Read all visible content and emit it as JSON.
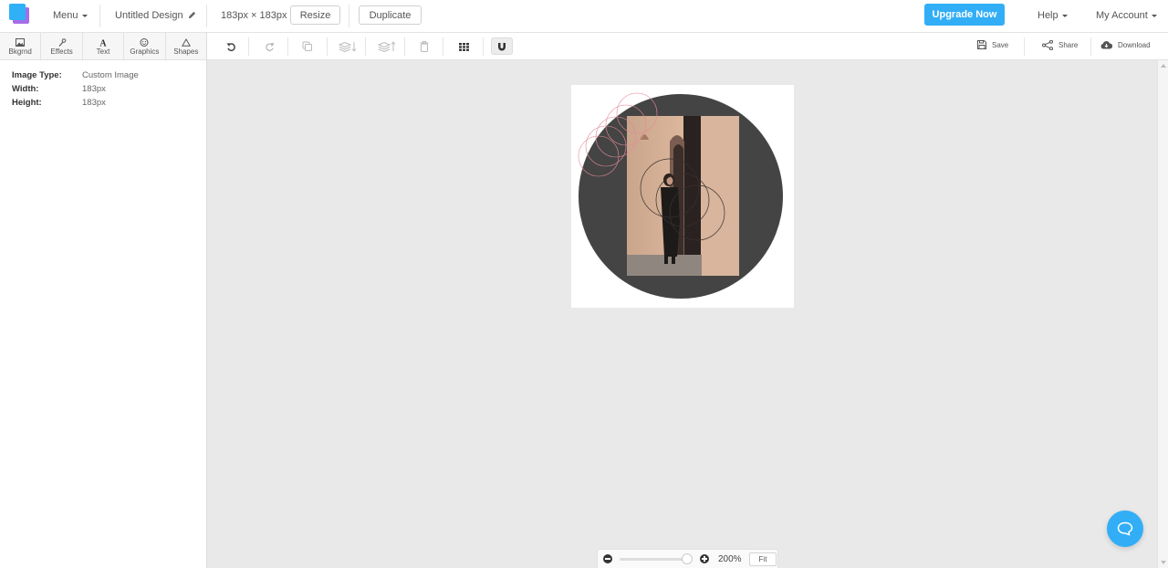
{
  "topbar": {
    "menu_label": "Menu",
    "design_name": "Untitled Design",
    "dimensions": "183px × 183px",
    "resize_label": "Resize",
    "duplicate_label": "Duplicate",
    "upgrade_label": "Upgrade Now",
    "help_label": "Help",
    "account_label": "My Account",
    "brand_color": "#32aef6"
  },
  "tool_tabs": [
    {
      "label": "Bkgrnd",
      "icon": "image-icon"
    },
    {
      "label": "Effects",
      "icon": "magic-wand-icon"
    },
    {
      "label": "Text",
      "icon": "text-icon"
    },
    {
      "label": "Graphics",
      "icon": "smiley-icon"
    },
    {
      "label": "Shapes",
      "icon": "triangle-icon"
    }
  ],
  "edit_toolbar": {
    "icons": [
      "undo-icon",
      "redo-icon",
      "duplicate-icon",
      "send-backward-icon",
      "bring-forward-icon",
      "delete-icon",
      "grid-icon",
      "magnet-icon"
    ],
    "save_label": "Save",
    "share_label": "Share",
    "download_label": "Download"
  },
  "properties": {
    "image_type_label": "Image Type:",
    "image_type_value": "Custom Image",
    "width_label": "Width:",
    "width_value": "183px",
    "height_label": "Height:",
    "height_value": "183px"
  },
  "canvas": {
    "background": "#ffffff",
    "circle_color": "#444444",
    "accent_circle_color": "#e58a98"
  },
  "zoom": {
    "value": "200%",
    "slider_fraction": 0.98,
    "fit_label": "Fit"
  }
}
